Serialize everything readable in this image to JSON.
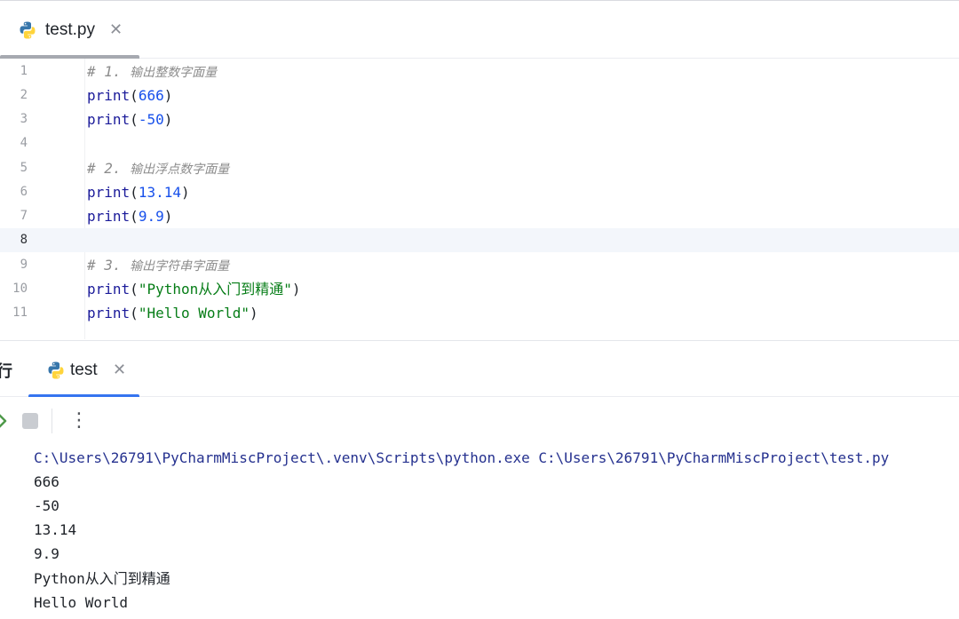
{
  "editor_tab": {
    "label": "test.py",
    "icon": "python-icon"
  },
  "code_lines": [
    {
      "no": "1",
      "kind": "comment",
      "prefix": "# 1. ",
      "text": "输出整数字面量"
    },
    {
      "no": "2",
      "kind": "call",
      "fn": "print",
      "open": "(",
      "arg": "666",
      "close": ")"
    },
    {
      "no": "3",
      "kind": "call",
      "fn": "print",
      "open": "(",
      "arg": "-50",
      "close": ")"
    },
    {
      "no": "4",
      "kind": "blank"
    },
    {
      "no": "5",
      "kind": "comment",
      "prefix": "# 2. ",
      "text": "输出浮点数字面量"
    },
    {
      "no": "6",
      "kind": "call",
      "fn": "print",
      "open": "(",
      "arg": "13.14",
      "close": ")"
    },
    {
      "no": "7",
      "kind": "call",
      "fn": "print",
      "open": "(",
      "arg": "9.9",
      "close": ")"
    },
    {
      "no": "8",
      "kind": "blank",
      "current": true
    },
    {
      "no": "9",
      "kind": "comment",
      "prefix": "# 3. ",
      "text": "输出字符串字面量"
    },
    {
      "no": "10",
      "kind": "call",
      "fn": "print",
      "open": "(",
      "arg": "\"Python从入门到精通\"",
      "close": ")"
    },
    {
      "no": "11",
      "kind": "call",
      "fn": "print",
      "open": "(",
      "arg": "\"Hello World\"",
      "close": ")"
    }
  ],
  "run_panel": {
    "title": "行",
    "tab_label": "test",
    "tab_icon": "python-icon"
  },
  "console": {
    "command": "C:\\Users\\26791\\PyCharmMiscProject\\.venv\\Scripts\\python.exe C:\\Users\\26791\\PyCharmMiscProject\\test.py",
    "output": [
      "666",
      "-50",
      "13.14",
      "9.9",
      "Python从入门到精通",
      "Hello World"
    ]
  },
  "colors": {
    "keyword": "#1b1b9a",
    "number": "#1750eb",
    "string": "#067d17",
    "comment": "#8c8c8c",
    "command": "#25318f",
    "current_line": "#f3f6fb",
    "active_tab_underline": "#3574f0",
    "python_blue": "#3776ab",
    "python_yellow": "#ffd43b"
  }
}
